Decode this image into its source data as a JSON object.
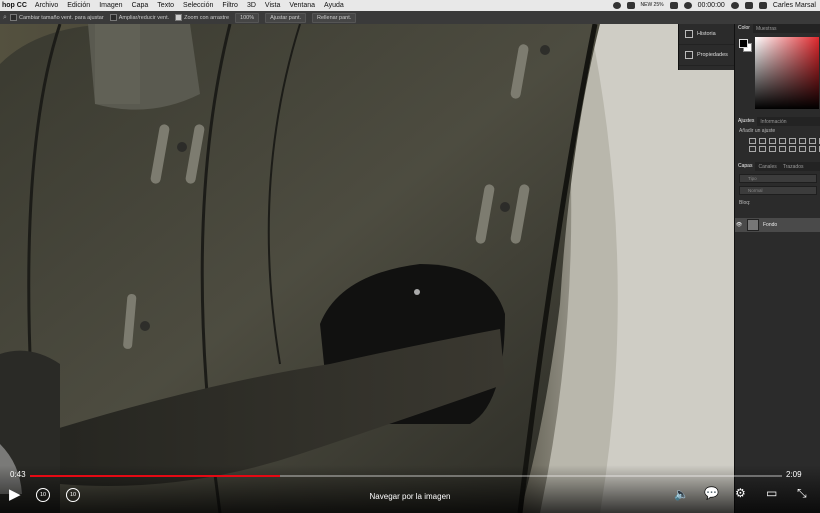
{
  "menubar": {
    "app": "hop CC",
    "items": [
      "Archivo",
      "Edición",
      "Imagen",
      "Capa",
      "Texto",
      "Selección",
      "Filtro",
      "3D",
      "Vista",
      "Ventana",
      "Ayuda"
    ],
    "clock": "00:00:00",
    "user": "Carles Marsal",
    "stat": "NEW 25%"
  },
  "options": {
    "cb1": "Cambiar tamaño vent. para ajustar",
    "cb2": "Ampliar/reducir vent.",
    "cb3": "Zoom con arrastre",
    "zoom": "100%",
    "btn1": "Ajustar pant.",
    "btn2": "Rellenar pant."
  },
  "dock": {
    "history": "Historia",
    "properties": "Propiedades"
  },
  "color_panel": {
    "tab1": "Color",
    "tab2": "Muestras"
  },
  "adjust_panel": {
    "tab1": "Ajustes",
    "tab2": "Información",
    "subtitle": "Añadir un ajuste"
  },
  "layers_panel": {
    "tab1": "Capas",
    "tab2": "Canales",
    "tab3": "Trazados",
    "kind": "Tipo",
    "blend": "Normal",
    "lock": "Bloq:",
    "layer_name": "Fondo"
  },
  "player": {
    "elapsed": "0:43",
    "remaining": "2:09",
    "progress": 0.333,
    "caption": "Navegar por la imagen",
    "skip_back": "10",
    "skip_fwd": "10"
  },
  "colors": {
    "accent": "#e50914",
    "ui_dark": "#2b2b2b"
  }
}
